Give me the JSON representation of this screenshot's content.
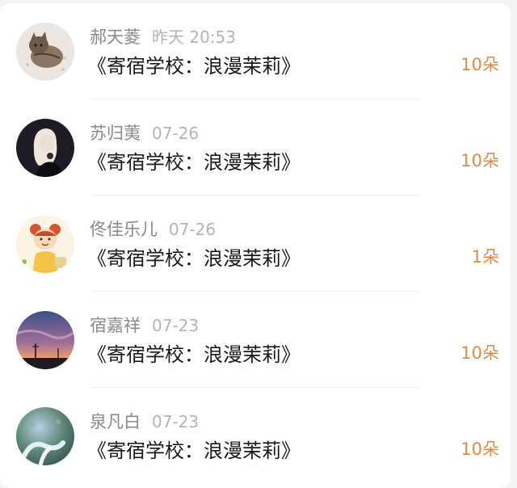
{
  "list": [
    {
      "name": "郝天菱",
      "date": "昨天 20:53",
      "title": "《寄宿学校：浪漫茉莉》",
      "count": "10朵",
      "avatar": "cat-photo"
    },
    {
      "name": "苏归荑",
      "date": "07-26",
      "title": "《寄宿学校：浪漫茉莉》",
      "count": "10朵",
      "avatar": "blonde-girl-photo"
    },
    {
      "name": "佟佳乐儿",
      "date": "07-26",
      "title": "《寄宿学校：浪漫茉莉》",
      "count": "1朵",
      "avatar": "cartoon-girl"
    },
    {
      "name": "宿嘉祥",
      "date": "07-23",
      "title": "《寄宿学校：浪漫茉莉》",
      "count": "10朵",
      "avatar": "sunset-sky-photo"
    },
    {
      "name": "泉凡白",
      "date": "07-23",
      "title": "《寄宿学校：浪漫茉莉》",
      "count": "10朵",
      "avatar": "peacock-photo"
    }
  ],
  "colors": {
    "count": "#e08a46",
    "name": "#8a8a8a",
    "date": "#b4b4b4",
    "title": "#1a1a1a"
  }
}
